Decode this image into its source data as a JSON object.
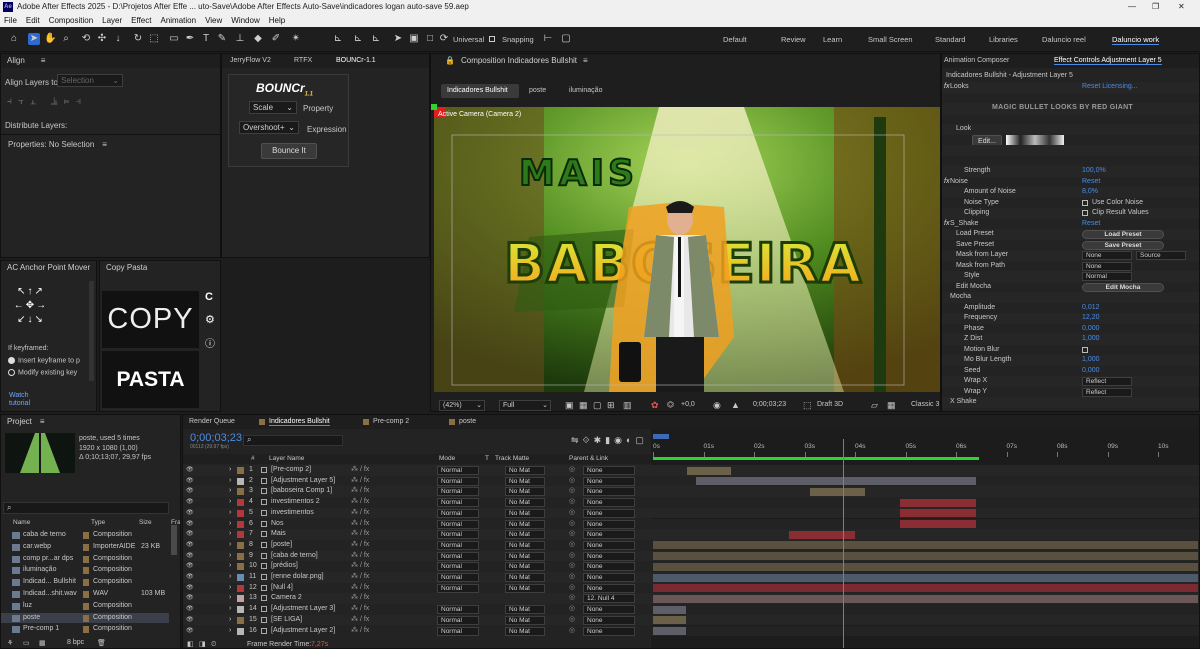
{
  "window": {
    "title": "Adobe After Effects 2025 - D:\\Projetos After Effe ... uto-Save\\Adobe After Effects Auto-Save\\indicadores logan auto-save 59.aep",
    "menu": [
      "File",
      "Edit",
      "Composition",
      "Layer",
      "Effect",
      "Animation",
      "View",
      "Window",
      "Help"
    ]
  },
  "toolbar": {
    "universal": "Universal",
    "snapping": "Snapping",
    "workspaces": [
      "Default",
      "Review",
      "Learn",
      "Small Screen",
      "Standard",
      "Libraries",
      "Daluncio reel",
      "Daluncio work"
    ],
    "active_workspace": "Daluncio work"
  },
  "align": {
    "title": "Align",
    "align_to_label": "Align Layers to:",
    "align_to_value": "Selection",
    "distribute": "Distribute Layers:",
    "properties": "Properties: No Selection"
  },
  "bounce": {
    "tabs": [
      "JerryFlow V2",
      "RTFX",
      "BOUNCr-1.1"
    ],
    "logo": "BOUNCr",
    "logo_ver": "1.1",
    "scale_dd": "Scale",
    "property_label": "Property",
    "overshoot_dd": "Overshoot+",
    "expression_label": "Expression",
    "bounce_btn": "Bounce It"
  },
  "anchor": {
    "title": "AC Anchor Point Mover",
    "if_keyframed": "If keyframed:",
    "opt1": "Insert keyframe to p",
    "opt2": "Modify existing key",
    "watch": "Watch tutorial"
  },
  "copypasta": {
    "title": "Copy Pasta",
    "copy": "COPY",
    "pasta": "PASTA"
  },
  "composition": {
    "title": "Composition Indicadores Bullshit",
    "breadcrumbs": [
      "Indicadores Bullshit",
      "poste",
      "iluminação"
    ],
    "camera": "Active Camera (Camera 2)",
    "zoom": "(42%)",
    "resolution": "Full",
    "exposure": "+0,0",
    "timecode": "0;00;03;23",
    "renderer": "Draft 3D",
    "view": "Classic 3",
    "art_text_1": "MAIS",
    "art_text_2": "BABOSEIRA"
  },
  "effects": {
    "tabs": [
      "Animation Composer",
      "Effect Controls Adjustment Layer 5"
    ],
    "header": "Indicadores Bullshit - Adjustment Layer 5",
    "rows": [
      {
        "label": "Looks",
        "value": "Reset   Licensing...",
        "indent": 8,
        "fx": true
      },
      {
        "label": "",
        "value": "",
        "indent": 8
      },
      {
        "label": "MAGIC BULLET LOOKS BY RED GIANT",
        "value": "",
        "indent": 50,
        "banner": true
      },
      {
        "label": "",
        "value": "",
        "indent": 8
      },
      {
        "label": "Look",
        "value": "",
        "indent": 14
      },
      {
        "label": "Edit...",
        "value": "",
        "indent": 30,
        "editbtn": true
      },
      {
        "label": "",
        "value": "",
        "indent": 8
      },
      {
        "label": "",
        "value": "",
        "indent": 8
      },
      {
        "label": "Strength",
        "value": "100,0%",
        "indent": 22
      },
      {
        "label": "Noise",
        "value": "Reset",
        "indent": 8,
        "fx": true
      },
      {
        "label": "Amount of Noise",
        "value": "8,0%",
        "indent": 22
      },
      {
        "label": "Noise Type",
        "value": "Use Color Noise",
        "indent": 22,
        "check": true
      },
      {
        "label": "Clipping",
        "value": "Clip Result Values",
        "indent": 22,
        "check": true
      },
      {
        "label": "S_Shake",
        "value": "Reset",
        "indent": 8,
        "fx": true
      },
      {
        "label": "Load Preset",
        "value": "Load Preset",
        "indent": 14,
        "button": true
      },
      {
        "label": "Save Preset",
        "value": "Save Preset",
        "indent": 14,
        "button": true
      },
      {
        "label": "Mask from Layer",
        "value": "None",
        "value2": "Source",
        "indent": 14,
        "dd": true
      },
      {
        "label": "Mask from Path",
        "value": "None",
        "indent": 14,
        "dd": true
      },
      {
        "label": "Style",
        "value": "Normal",
        "indent": 22,
        "dd": true
      },
      {
        "label": "Edit Mocha",
        "value": "Edit Mocha",
        "indent": 14,
        "button": true
      },
      {
        "label": "Mocha",
        "value": "",
        "indent": 8
      },
      {
        "label": "Amplitude",
        "value": "0,012",
        "indent": 22
      },
      {
        "label": "Frequency",
        "value": "12,20",
        "indent": 22
      },
      {
        "label": "Phase",
        "value": "0,000",
        "indent": 22
      },
      {
        "label": "Z Dist",
        "value": "1,000",
        "indent": 22
      },
      {
        "label": "Motion Blur",
        "value": "",
        "indent": 22,
        "check": true
      },
      {
        "label": "Mo Blur Length",
        "value": "1,000",
        "indent": 22
      },
      {
        "label": "Seed",
        "value": "0,000",
        "indent": 22
      },
      {
        "label": "Wrap X",
        "value": "Reflect",
        "indent": 22,
        "dd": true
      },
      {
        "label": "Wrap Y",
        "value": "Reflect",
        "indent": 22,
        "dd": true
      },
      {
        "label": "X Shake",
        "value": "",
        "indent": 8
      }
    ]
  },
  "project": {
    "title": "Project",
    "selected": "poste",
    "used": ", used 5 times",
    "dims": "1920 x 1080 (1,00)",
    "duration": "Δ 0;10;13;07, 29,97 fps",
    "columns": [
      "Name",
      "Type",
      "Size",
      "Fra"
    ],
    "items": [
      {
        "name": "caba de terno",
        "type": "Composition",
        "size": ""
      },
      {
        "name": "car.webp",
        "type": "ImporterAIDE",
        "size": "23 KB"
      },
      {
        "name": "comp pr...ar dps",
        "type": "Composition",
        "size": ""
      },
      {
        "name": "iluminação",
        "type": "Composition",
        "size": ""
      },
      {
        "name": "Indicad... Bullshit",
        "type": "Composition",
        "size": ""
      },
      {
        "name": "Indicad...shit.wav",
        "type": "WAV",
        "size": "103 MB"
      },
      {
        "name": "luz",
        "type": "Composition",
        "size": ""
      },
      {
        "name": "poste",
        "type": "Composition",
        "size": ""
      },
      {
        "name": "Pre-comp 1",
        "type": "Composition",
        "size": ""
      }
    ],
    "bpc": "8 bpc"
  },
  "timeline": {
    "tabs": [
      "Render Queue",
      "Indicadores Bullshit",
      "Pre-comp 2",
      "poste"
    ],
    "timecode": "0;00;03;23",
    "timecode_sub": "00113 (29.97 fps)",
    "columns": {
      "num": "#",
      "name": "Layer Name",
      "mode": "Mode",
      "t": "T",
      "matte": "Track Matte",
      "parent": "Parent & Link"
    },
    "ruler": [
      "0s",
      "01s",
      "02s",
      "03s",
      "04s",
      "05s",
      "06s",
      "07s",
      "08s",
      "09s",
      "10s"
    ],
    "footer": "Frame Render Time:",
    "render_time": "7,27s",
    "layers": [
      {
        "n": "1",
        "name": "[Pre-comp 2]",
        "color": "#8a6f45",
        "mode": "Normal",
        "matte": "No Mat",
        "parent": "None",
        "start": 0.68,
        "end": 1.55,
        "bar": "#6b6048"
      },
      {
        "n": "2",
        "name": "[Adjustment Layer 5]",
        "color": "#b7b7b7",
        "mode": "Normal",
        "matte": "No Mat",
        "parent": "None",
        "start": 0.85,
        "end": 6.4,
        "bar": "#5e5e68"
      },
      {
        "n": "3",
        "name": "[baboseira Comp 1]",
        "color": "#8a6f45",
        "mode": "Normal",
        "matte": "No Mat",
        "parent": "None",
        "start": 3.1,
        "end": 4.2,
        "bar": "#6b6048"
      },
      {
        "n": "4",
        "name": "investimentos 2",
        "color": "#b3383c",
        "mode": "Normal",
        "matte": "No Mat",
        "parent": "None",
        "start": 4.9,
        "end": 6.4,
        "bar": "#8a2e33"
      },
      {
        "n": "5",
        "name": "investimentos",
        "color": "#b3383c",
        "mode": "Normal",
        "matte": "No Mat",
        "parent": "None",
        "start": 4.9,
        "end": 6.4,
        "bar": "#8a2e33"
      },
      {
        "n": "6",
        "name": "Nos",
        "color": "#b3383c",
        "mode": "Normal",
        "matte": "No Mat",
        "parent": "None",
        "start": 4.9,
        "end": 6.4,
        "bar": "#8a2e33"
      },
      {
        "n": "7",
        "name": "Mais",
        "color": "#b3383c",
        "mode": "Normal",
        "matte": "No Mat",
        "parent": "None",
        "start": 2.7,
        "end": 4.0,
        "bar": "#8a2e33"
      },
      {
        "n": "8",
        "name": "[poste]",
        "color": "#8a6f45",
        "mode": "Normal",
        "matte": "No Mat",
        "parent": "None",
        "start": 0.0,
        "end": 10.8,
        "bar": "#5a5040"
      },
      {
        "n": "9",
        "name": "[caba de terno]",
        "color": "#8a6f45",
        "mode": "Normal",
        "matte": "No Mat",
        "parent": "None",
        "start": 0.0,
        "end": 10.8,
        "bar": "#5a5040"
      },
      {
        "n": "10",
        "name": "[prédios]",
        "color": "#8a6f45",
        "mode": "Normal",
        "matte": "No Mat",
        "parent": "None",
        "start": 0.0,
        "end": 10.8,
        "bar": "#5a5040"
      },
      {
        "n": "11",
        "name": "[renne dolar.png]",
        "color": "#6a8db5",
        "mode": "Normal",
        "matte": "No Mat",
        "parent": "None",
        "start": 0.0,
        "end": 10.8,
        "bar": "#4d5a6b"
      },
      {
        "n": "12",
        "name": "[Null 4]",
        "color": "#b3383c",
        "mode": "Normal",
        "matte": "No Mat",
        "parent": "None",
        "start": 0.0,
        "end": 10.8,
        "bar": "#7a2a30"
      },
      {
        "n": "13",
        "name": "Camera 2",
        "color": "#c4a2a2",
        "mode": "",
        "matte": "",
        "parent": "12. Null 4",
        "start": 0.0,
        "end": 10.8,
        "bar": "#6a5858"
      },
      {
        "n": "14",
        "name": "[Adjustment Layer 3]",
        "color": "#b7b7b7",
        "mode": "Normal",
        "matte": "No Mat",
        "parent": "None",
        "start": 0.0,
        "end": 0.65,
        "bar": "#5e5e68"
      },
      {
        "n": "15",
        "name": "[SE LIGA]",
        "color": "#8a6f45",
        "mode": "Normal",
        "matte": "No Mat",
        "parent": "None",
        "start": 0.0,
        "end": 0.65,
        "bar": "#6b6048"
      },
      {
        "n": "16",
        "name": "[Adjustment Layer 2]",
        "color": "#b7b7b7",
        "mode": "Normal",
        "matte": "No Mat",
        "parent": "None",
        "start": 0.0,
        "end": 0.65,
        "bar": "#5e5e68"
      }
    ],
    "playhead_seconds": 3.77
  }
}
